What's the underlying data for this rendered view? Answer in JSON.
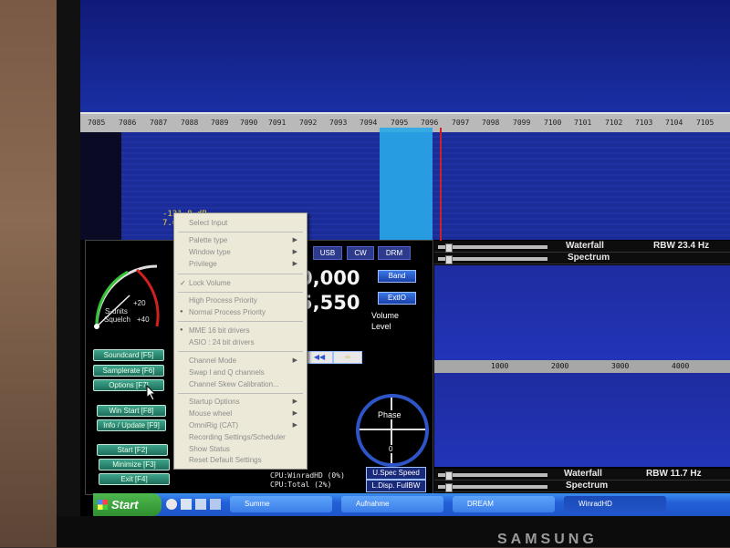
{
  "monitor": {
    "brand": "SAMSUNG"
  },
  "ruler_top": {
    "ticks": [
      "7085",
      "7086",
      "7087",
      "7088",
      "7089",
      "7090",
      "7091",
      "7092",
      "7093",
      "7094",
      "7095",
      "7096",
      "7097",
      "7098",
      "7099",
      "7100",
      "7101",
      "7102",
      "7103",
      "7104",
      "7105"
    ]
  },
  "signal": {
    "db_line1": "-131.8 dB",
    "db_line2": "7.0"
  },
  "smeter": {
    "label1": "S-units",
    "label2": "Squelch",
    "plus20": "+20",
    "plus40": "+40"
  },
  "left_buttons": [
    "Soundcard [F5]",
    "Samplerate [F6]",
    "Options [F7]",
    "Win Start [F8]",
    "Info / Update [F9]",
    "Start [F2]",
    "Minimize [F3]",
    "Exit [F4]"
  ],
  "freq": {
    "line1": "0,000",
    "line2": "5,550"
  },
  "modes": [
    "USB",
    "CW",
    "DRM"
  ],
  "blue_buttons": {
    "band": "Band",
    "extio": "ExtIO"
  },
  "volume": {
    "label1": "Volume",
    "label2": "Level"
  },
  "playback": {
    "rew": "◀◀",
    "loop": "∞"
  },
  "phase": {
    "label": "Phase",
    "zero": "0"
  },
  "cpu": {
    "line1": "CPU:WinradHD (0%)",
    "line2": "CPU:Total    (2%)"
  },
  "bottom_buttons": {
    "spec_speed": "U.Spec Speed",
    "disp_full": "L.Disp. FullBW"
  },
  "right_panel": {
    "top_waterfall": "Waterfall",
    "top_spectrum": "Spectrum",
    "top_rbw": "RBW 23.4 Hz",
    "ruler": [
      "1000",
      "2000",
      "3000",
      "4000"
    ],
    "bottom_waterfall": "Waterfall",
    "bottom_spectrum": "Spectrum",
    "bottom_rbw": "RBW 11.7 Hz"
  },
  "context_menu": {
    "items": [
      {
        "label": "Select Input",
        "arrow": ""
      },
      {
        "label": "Palette type",
        "arrow": "▶"
      },
      {
        "label": "Window type",
        "arrow": "▶"
      },
      {
        "label": "Privilege",
        "arrow": "▶"
      },
      {
        "label": "Lock Volume",
        "arrow": ""
      },
      {
        "label": "High Process Priority",
        "arrow": ""
      },
      {
        "label": "Normal Process Priority",
        "arrow": ""
      },
      {
        "label": "MME 16 bit drivers",
        "arrow": ""
      },
      {
        "label": "ASIO : 24 bit drivers",
        "arrow": ""
      },
      {
        "label": "Channel Mode",
        "arrow": "▶"
      },
      {
        "label": "Swap I and Q channels",
        "arrow": ""
      },
      {
        "label": "Channel Skew Calibration...",
        "arrow": ""
      },
      {
        "label": "Startup Options",
        "arrow": "▶"
      },
      {
        "label": "Mouse wheel",
        "arrow": "▶"
      },
      {
        "label": "OmniRig (CAT)",
        "arrow": "▶"
      },
      {
        "label": "Recording Settings/Scheduler",
        "arrow": ""
      },
      {
        "label": "Show Status",
        "arrow": ""
      },
      {
        "label": "Reset Default Settings",
        "arrow": ""
      }
    ]
  },
  "taskbar": {
    "start": "Start",
    "tasks": [
      "Summe",
      "Aufnahme",
      "DREAM",
      "WinradHD"
    ]
  },
  "colors": {
    "accent_blue": "#2a3fb0",
    "passband": "#2aa8e8",
    "marker": "#d02020",
    "button_green": "#2e8a74",
    "taskbar": "#2360d8"
  }
}
